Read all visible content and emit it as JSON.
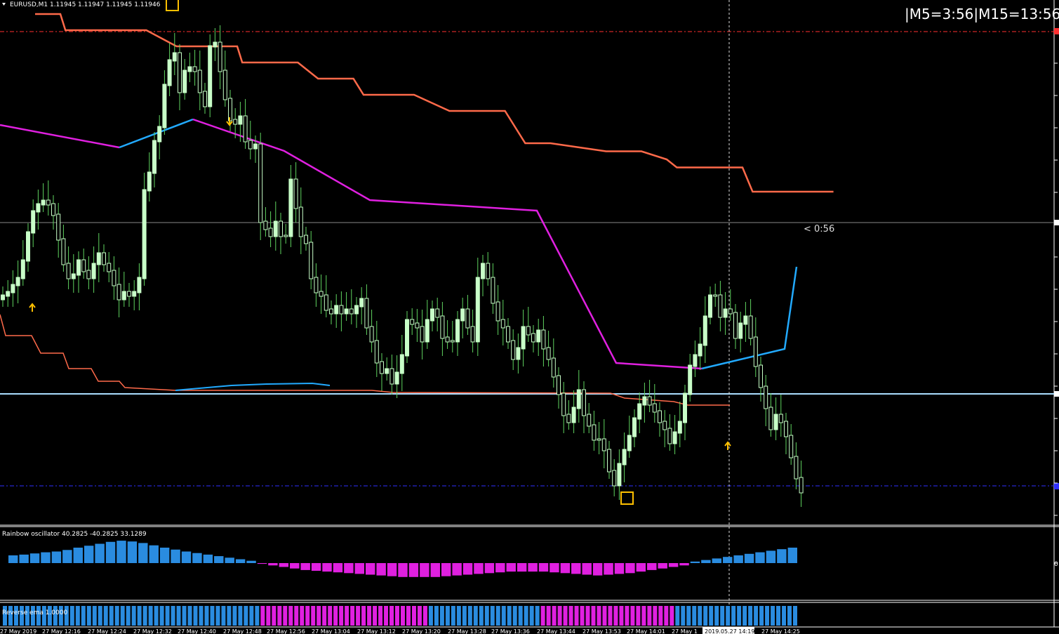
{
  "window": {
    "symbol_label": "EURUSD,M1  1.11945 1.11947 1.11945 1.11946",
    "timer_label": "|M5=3:56|M15=13:56",
    "countdown_label": "< 0:56",
    "cursor_time_label": "2019.05.27 14:19"
  },
  "colors": {
    "background": "#000000",
    "candle": "#c8ffc8",
    "wick": "#5fd35f",
    "upper_band": "#ff6a4a",
    "lower_band": "#ff6a4a",
    "trend_bear": "#e020e0",
    "trend_bull": "#22aaff",
    "hline": "#aaddff",
    "resistance": "#ff3030",
    "support": "#3030ff",
    "arrow": "#ffc000",
    "osc_bull": "#2a8ce0",
    "osc_bear": "#e020e0"
  },
  "indicators": {
    "rainbow_label": "Rainbow oscillator  40.2825 -40.2825 33.1289",
    "reverse_label": "Reverse ema 1.0000",
    "osc_zero_label": "0"
  },
  "x_axis": {
    "labels": [
      "27 May 2019",
      "27 May 12:16",
      "27 May 12:24",
      "27 May 12:32",
      "27 May 12:40",
      "27 May 12:48",
      "27 May 12:56",
      "27 May 13:04",
      "27 May 13:12",
      "27 May 13:20",
      "27 May 13:28",
      "27 May 13:36",
      "27 May 13:44",
      "27 May 13:53",
      "27 May 14:01",
      "27 May 1",
      "27 May 14:25"
    ]
  },
  "chart_data": {
    "type": "candlestick",
    "symbol": "EURUSD",
    "timeframe": "M1",
    "candles": [
      [
        0,
        420,
        430,
        380,
        470
      ],
      [
        1,
        420,
        410,
        370,
        440
      ],
      [
        2,
        410,
        395,
        360,
        440
      ],
      [
        3,
        415,
        380,
        340,
        430
      ],
      [
        4,
        370,
        350,
        330,
        400
      ],
      [
        5,
        330,
        310,
        300,
        345
      ],
      [
        6,
        300,
        280,
        265,
        320
      ],
      [
        7,
        290,
        282,
        270,
        300
      ],
      [
        8,
        280,
        275,
        255,
        300
      ],
      [
        9,
        285,
        290,
        275,
        310
      ],
      [
        10,
        300,
        330,
        290,
        350
      ],
      [
        11,
        340,
        370,
        330,
        410
      ],
      [
        12,
        370,
        400,
        360,
        410
      ],
      [
        13,
        390,
        400,
        350,
        420
      ],
      [
        14,
        385,
        370,
        340,
        400
      ],
      [
        15,
        360,
        380,
        350,
        410
      ],
      [
        16,
        380,
        400,
        360,
        430
      ],
      [
        17,
        400,
        380,
        370,
        440
      ],
      [
        18,
        380,
        360,
        340,
        390
      ],
      [
        19,
        350,
        370,
        340,
        380
      ],
      [
        20,
        370,
        380,
        355,
        390
      ],
      [
        21,
        375,
        395,
        360,
        420
      ],
      [
        22,
        390,
        420,
        380,
        430
      ],
      [
        23,
        420,
        430,
        400,
        440
      ],
      [
        24,
        410,
        420,
        400,
        440
      ],
      [
        25,
        410,
        430,
        400,
        440
      ],
      [
        26,
        420,
        410,
        400,
        430
      ],
      [
        27,
        400,
        370,
        350,
        410
      ],
      [
        28,
        300,
        280,
        270,
        350
      ],
      [
        29,
        280,
        250,
        240,
        290
      ],
      [
        30,
        250,
        200,
        180,
        260
      ],
      [
        31,
        190,
        180,
        170,
        200
      ],
      [
        32,
        180,
        120,
        90,
        190
      ],
      [
        33,
        110,
        80,
        60,
        130
      ],
      [
        34,
        90,
        70,
        55,
        100
      ],
      [
        35,
        100,
        130,
        90,
        150
      ],
      [
        36,
        120,
        100,
        80,
        130
      ],
      [
        37,
        100,
        95,
        90,
        105
      ],
      [
        38,
        95,
        100,
        90,
        105
      ],
      [
        39,
        100,
        130,
        90,
        150
      ],
      [
        40,
        120,
        150,
        95,
        170
      ],
      [
        41,
        100,
        60,
        45,
        110
      ],
      [
        42,
        55,
        60,
        45,
        80
      ],
      [
        43,
        70,
        100,
        60,
        110
      ],
      [
        44,
        60,
        130,
        55,
        160
      ],
      [
        45,
        130,
        160,
        120,
        210
      ],
      [
        46,
        160,
        180,
        150,
        220
      ],
      [
        47,
        170,
        165,
        150,
        190
      ],
      [
        48,
        170,
        200,
        160,
        210
      ],
      [
        49,
        190,
        210,
        180,
        215
      ],
      [
        50,
        205,
        210,
        200,
        215
      ],
      [
        51,
        220,
        320,
        210,
        330
      ],
      [
        52,
        310,
        330,
        300,
        340
      ],
      [
        53,
        320,
        340,
        300,
        350
      ],
      [
        54,
        300,
        320,
        290,
        360
      ],
      [
        55,
        330,
        340,
        320,
        350
      ],
      [
        56,
        345,
        320,
        300,
        360
      ],
      [
        57,
        270,
        250,
        235,
        280
      ],
      [
        58,
        260,
        300,
        240,
        320
      ],
      [
        59,
        300,
        340,
        290,
        350
      ],
      [
        60,
        350,
        340,
        320,
        380
      ],
      [
        61,
        300,
        400,
        290,
        410
      ],
      [
        62,
        400,
        420,
        380,
        440
      ],
      [
        63,
        410,
        420,
        380,
        460
      ],
      [
        64,
        420,
        450,
        400,
        510
      ],
      [
        65,
        440,
        450,
        430,
        460
      ],
      [
        66,
        450,
        430,
        400,
        470
      ],
      [
        67,
        420,
        450,
        400,
        480
      ],
      [
        68,
        440,
        440,
        420,
        470
      ],
      [
        69,
        430,
        450,
        420,
        470
      ],
      [
        70,
        440,
        430,
        400,
        450
      ],
      [
        71,
        430,
        420,
        400,
        440
      ],
      [
        72,
        420,
        470,
        410,
        480
      ],
      [
        73,
        470,
        490,
        440,
        500
      ],
      [
        74,
        480,
        520,
        460,
        540
      ],
      [
        75,
        520,
        530,
        500,
        540
      ],
      [
        76,
        525,
        520,
        510,
        530
      ],
      [
        77,
        530,
        550,
        520,
        580
      ],
      [
        78,
        540,
        530,
        500,
        570
      ],
      [
        79,
        520,
        505,
        480,
        530
      ],
      [
        80,
        505,
        450,
        440,
        510
      ],
      [
        81,
        450,
        460,
        440,
        480
      ],
      [
        82,
        455,
        470,
        440,
        500
      ],
      [
        83,
        470,
        490,
        460,
        500
      ],
      [
        84,
        480,
        450,
        440,
        500
      ],
      [
        85,
        450,
        440,
        430,
        470
      ],
      [
        86,
        440,
        455,
        430,
        470
      ],
      [
        87,
        455,
        490,
        450,
        500
      ],
      [
        88,
        490,
        480,
        470,
        500
      ],
      [
        89,
        480,
        490,
        470,
        510
      ],
      [
        90,
        490,
        460,
        450,
        500
      ],
      [
        91,
        460,
        440,
        430,
        480
      ],
      [
        92,
        440,
        470,
        430,
        480
      ],
      [
        93,
        470,
        490,
        460,
        500
      ],
      [
        94,
        490,
        400,
        380,
        500
      ],
      [
        95,
        400,
        380,
        370,
        420
      ],
      [
        96,
        380,
        400,
        370,
        420
      ],
      [
        97,
        400,
        440,
        390,
        450
      ],
      [
        98,
        440,
        460,
        430,
        470
      ],
      [
        99,
        460,
        470,
        455,
        480
      ],
      [
        100,
        470,
        490,
        460,
        500
      ],
      [
        101,
        490,
        520,
        480,
        560
      ],
      [
        102,
        520,
        500,
        490,
        530
      ],
      [
        103,
        490,
        470,
        460,
        500
      ],
      [
        104,
        470,
        480,
        450,
        500
      ],
      [
        105,
        480,
        490,
        470,
        510
      ],
      [
        106,
        490,
        470,
        460,
        500
      ],
      [
        107,
        470,
        500,
        460,
        520
      ],
      [
        108,
        500,
        520,
        490,
        530
      ],
      [
        109,
        520,
        540,
        500,
        560
      ],
      [
        110,
        540,
        570,
        530,
        590
      ],
      [
        111,
        570,
        600,
        560,
        620
      ],
      [
        112,
        600,
        610,
        590,
        630
      ],
      [
        113,
        600,
        560,
        550,
        620
      ],
      [
        114,
        560,
        550,
        540,
        580
      ],
      [
        115,
        550,
        600,
        540,
        620
      ],
      [
        116,
        600,
        610,
        590,
        640
      ],
      [
        117,
        610,
        640,
        600,
        660
      ],
      [
        118,
        640,
        630,
        620,
        650
      ],
      [
        119,
        630,
        680,
        620,
        700
      ],
      [
        120,
        680,
        700,
        670,
        720
      ],
      [
        121,
        700,
        720,
        690,
        740
      ],
      [
        122,
        720,
        690,
        680,
        730
      ],
      [
        123,
        690,
        650,
        630,
        700
      ],
      [
        124,
        650,
        640,
        630,
        680
      ],
      [
        125,
        640,
        610,
        600,
        660
      ],
      [
        126,
        610,
        580,
        570,
        620
      ],
      [
        127,
        580,
        570,
        560,
        600
      ],
      [
        128,
        570,
        560,
        550,
        590
      ],
      [
        129,
        560,
        580,
        550,
        600
      ],
      [
        130,
        580,
        590,
        570,
        610
      ],
      [
        131,
        590,
        600,
        580,
        620
      ],
      [
        132,
        600,
        620,
        590,
        630
      ],
      [
        133,
        620,
        640,
        610,
        650
      ],
      [
        134,
        640,
        620,
        610,
        660
      ],
      [
        135,
        620,
        600,
        590,
        630
      ],
      [
        136,
        600,
        560,
        540,
        610
      ],
      [
        137,
        560,
        520,
        500,
        570
      ],
      [
        138,
        520,
        500,
        490,
        540
      ],
      [
        139,
        500,
        480,
        470,
        520
      ],
      [
        140,
        480,
        440,
        420,
        500
      ],
      [
        141,
        440,
        410,
        390,
        460
      ],
      [
        142,
        410,
        420,
        380,
        450
      ],
      [
        143,
        420,
        460,
        400,
        500
      ],
      [
        144,
        460,
        440,
        420,
        480
      ],
      [
        145,
        440,
        450,
        430,
        470
      ],
      [
        146,
        450,
        490,
        440,
        500
      ],
      [
        147,
        490,
        470,
        460,
        500
      ],
      [
        148,
        470,
        450,
        440,
        480
      ],
      [
        149,
        450,
        490,
        440,
        520
      ],
      [
        150,
        490,
        540,
        480,
        560
      ],
      [
        151,
        540,
        570,
        530,
        590
      ],
      [
        152,
        570,
        610,
        550,
        640
      ],
      [
        153,
        610,
        620,
        600,
        660
      ],
      [
        154,
        620,
        590,
        570,
        640
      ],
      [
        155,
        590,
        600,
        580,
        620
      ],
      [
        156,
        600,
        630,
        590,
        650
      ],
      [
        157,
        630,
        680,
        620,
        700
      ],
      [
        158,
        680,
        720,
        670,
        740
      ],
      [
        159,
        720,
        740,
        710,
        760
      ]
    ],
    "candle_note": "values: [index, open, close, low, high] in chart units",
    "upper_band_steps": [
      [
        0,
        0
      ],
      [
        5,
        0
      ],
      [
        6,
        10
      ],
      [
        22,
        10
      ],
      [
        28,
        20
      ],
      [
        40,
        20
      ],
      [
        41,
        30
      ],
      [
        52,
        30
      ],
      [
        56,
        40
      ],
      [
        63,
        40
      ],
      [
        65,
        50
      ],
      [
        75,
        50
      ],
      [
        82,
        60
      ],
      [
        93,
        60
      ],
      [
        95,
        70
      ],
      [
        97,
        80
      ],
      [
        102,
        80
      ],
      [
        113,
        85
      ],
      [
        120,
        85
      ],
      [
        125,
        90
      ],
      [
        127,
        95
      ],
      [
        140,
        95
      ],
      [
        142,
        110
      ],
      [
        158,
        110
      ]
    ],
    "trend_line": [
      [
        0,
        180
      ],
      [
        20,
        210
      ],
      [
        32,
        175
      ],
      [
        45,
        215
      ],
      [
        60,
        285
      ],
      [
        90,
        300
      ],
      [
        100,
        520
      ],
      [
        125,
        525
      ],
      [
        140,
        510
      ],
      [
        157,
        495
      ],
      [
        159,
        380
      ]
    ],
    "osc_values": [
      20,
      22,
      25,
      28,
      30,
      34,
      40,
      45,
      50,
      55,
      58,
      56,
      52,
      46,
      40,
      35,
      30,
      26,
      22,
      18,
      14,
      10,
      6,
      -2,
      -6,
      -10,
      -14,
      -18,
      -20,
      -22,
      -24,
      -26,
      -28,
      -30,
      -32,
      -34,
      -36,
      -36,
      -36,
      -36,
      -34,
      -32,
      -30,
      -28,
      -26,
      -24,
      -22,
      -22,
      -22,
      -22,
      -24,
      -26,
      -28,
      -30,
      -32,
      -30,
      -28,
      -26,
      -22,
      -18,
      -14,
      -10,
      -6,
      4,
      8,
      12,
      16,
      20,
      24,
      28,
      32,
      36,
      40
    ],
    "reverse_segments": [
      [
        "bull",
        0,
        46
      ],
      [
        "bear",
        46,
        76
      ],
      [
        "bull",
        76,
        96
      ],
      [
        "bear",
        96,
        120
      ],
      [
        "bull",
        120,
        142
      ]
    ]
  }
}
